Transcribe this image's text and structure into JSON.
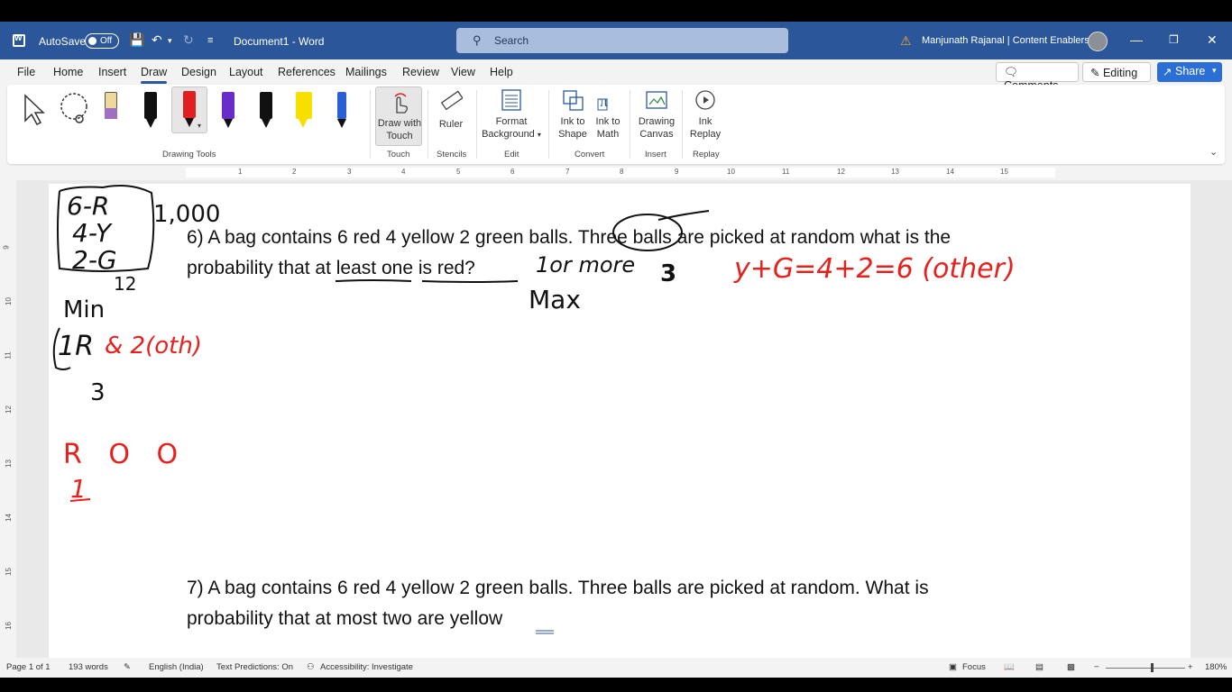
{
  "titlebar": {
    "autosave_label": "AutoSave",
    "autosave_state": "Off",
    "document_title": "Document1  -  Word",
    "search_placeholder": "Search",
    "user_name": "Manjunath Rajanal | Content Enablers"
  },
  "menu": {
    "tabs": [
      "File",
      "Home",
      "Insert",
      "Draw",
      "Design",
      "Layout",
      "References",
      "Mailings",
      "Review",
      "View",
      "Help"
    ],
    "active_tab": "Draw",
    "comments_label": "Comments",
    "editing_label": "Editing",
    "share_label": "Share"
  },
  "ribbon": {
    "groups": {
      "drawing_tools": "Drawing Tools",
      "touch": "Touch",
      "stencils": "Stencils",
      "edit": "Edit",
      "convert": "Convert",
      "insert": "Insert",
      "replay": "Replay"
    },
    "buttons": {
      "draw_with_touch": [
        "Draw with",
        "Touch"
      ],
      "ruler": "Ruler",
      "format_background": [
        "Format",
        "Background"
      ],
      "ink_to_shape": [
        "Ink to",
        "Shape"
      ],
      "ink_to_math": [
        "Ink to",
        "Math"
      ],
      "drawing_canvas": [
        "Drawing",
        "Canvas"
      ],
      "ink_replay": [
        "Ink",
        "Replay"
      ]
    },
    "pen_colors": [
      "#f0d898",
      "#111111",
      "#e02020",
      "#6a2cc8",
      "#111111",
      "#f5e000",
      "#2a5fd8"
    ]
  },
  "ruler_numbers": [
    "1",
    "2",
    "3",
    "4",
    "5",
    "6",
    "7",
    "8",
    "9",
    "10",
    "11",
    "12",
    "13",
    "14",
    "15"
  ],
  "vruler_numbers": [
    "9",
    "10",
    "11",
    "12",
    "13",
    "14",
    "15",
    "16"
  ],
  "document": {
    "q6_line1": "6)  A bag contains 6 red 4 yellow 2 green balls. Three balls are picked at random what is the",
    "q6_line2": "probability that at least one is red?",
    "q7_line1": "7) A bag contains 6 red 4 yellow 2 green balls. Three balls are picked at random. What is",
    "q7_line2": "probability that at most two are yellow"
  },
  "ink_annotations": {
    "box": [
      "6-R",
      "4-Y",
      "2-G"
    ],
    "thousand": "1,000",
    "twelve": "12",
    "min": "Min",
    "one_r": "1R",
    "amp_two_other": "& 2(oth)",
    "three": "3",
    "roo": "R O O",
    "one": "1",
    "ten_or_more": "1or more",
    "three_over": "3",
    "max": "Max",
    "y_g": "y+G=4+2=6  (other)"
  },
  "statusbar": {
    "page": "Page 1 of 1",
    "words": "193 words",
    "language": "English (India)",
    "predictions": "Text Predictions: On",
    "accessibility": "Accessibility: Investigate",
    "focus": "Focus",
    "zoom": "180%"
  },
  "colors": {
    "titlebar": "#2b579a",
    "ink_black": "#111111",
    "ink_red": "#e8201c",
    "accent": "#2b6fd6"
  }
}
